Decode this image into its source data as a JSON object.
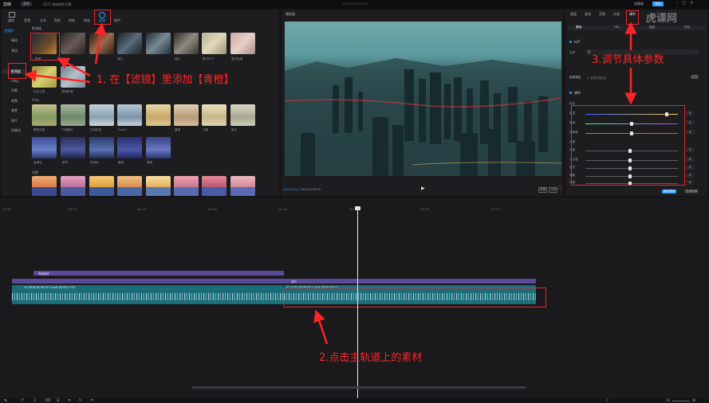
{
  "app": {
    "name": "剪映",
    "menu": "菜单",
    "project": "0127 剪映调色专题",
    "center_time": "0000-00-00 00:00",
    "export": "导出",
    "quick": "快捷键"
  },
  "toolbar": {
    "tabs": [
      "媒体",
      "音频",
      "文本",
      "贴纸",
      "特效",
      "转场",
      "滤镜",
      "调节"
    ],
    "active": "滤镜"
  },
  "filter_categories": {
    "items": [
      "·滤镜库",
      "精选",
      "潮流",
      "影视级",
      "Vlog",
      "风景",
      "夜景",
      "美食",
      "胶片",
      "风格化"
    ]
  },
  "sections": {
    "selected": "影视级",
    "vlog": "Vlog",
    "scenery": "风景"
  },
  "filters": {
    "row1": [
      "青橙",
      "暗夜",
      "落日",
      "高饱和",
      "蓝灯",
      "复古PCS",
      "复古色调"
    ],
    "row2": [
      "月光之夏",
      "港风影调"
    ],
    "row3": [
      "暖阳初夏",
      "中调暖光",
      "日系胶卷",
      "Sweet",
      "晨雾",
      "印象",
      "暮光"
    ],
    "row4": [
      "蓝调北",
      "都市",
      "低饱和",
      "暖青",
      "柔和"
    ]
  },
  "player": {
    "title": "播放器",
    "current": "00:00:02:17",
    "total": "00:00:03:05",
    "ratio": "比例",
    "quality": "原图"
  },
  "inspector": {
    "tabs": [
      "画面",
      "变速",
      "音频",
      "动画",
      "调节"
    ],
    "subtabs": [
      "基础",
      "HSL",
      "曲线",
      "色轮"
    ],
    "lut_label": "LUT",
    "name_label": "名称",
    "name_value": "无",
    "smart_label": "智能调色",
    "smart_hint": "AI 智能调整色彩",
    "adjust_label": "调节",
    "color_label": "色彩",
    "effect_label": "效果",
    "sliders": [
      {
        "label": "色温",
        "value": "0"
      },
      {
        "label": "色调",
        "value": "0"
      },
      {
        "label": "饱和度",
        "value": "0"
      },
      {
        "label": "亮度",
        "value": "0"
      },
      {
        "label": "对比度",
        "value": "0"
      },
      {
        "label": "高光",
        "value": "0"
      },
      {
        "label": "阴影",
        "value": "0"
      },
      {
        "label": "光感",
        "value": "0"
      }
    ],
    "save_preset": "保存预设",
    "apply_all": "应用全部"
  },
  "timeline": {
    "ticks": [
      "00:00",
      "|00:10",
      "|00:20",
      "|00:30",
      "|00:40",
      "|00:50",
      "|01:00",
      "|01:10"
    ],
    "filter_track_label": "青橙滤镜",
    "adjust_track_label": "调节",
    "clip1_label": "V1-0016 4K 00:00 1.mp4   00:00:17:23",
    "clip2_label": "V1-0102 4K 00:00 1.mp4   00:00:16:11"
  },
  "annotations": {
    "step1": "1.  在【滤镜】里添加【青橙】",
    "step2": "2.点击主轨道上的素材",
    "step3": "3.调节具体参数"
  },
  "watermark": "虎课网",
  "colors": {
    "accent": "#2f9bff",
    "annotation": "#ff2424",
    "clip": "#1b6d7a",
    "purple": "#5a4a9a"
  }
}
